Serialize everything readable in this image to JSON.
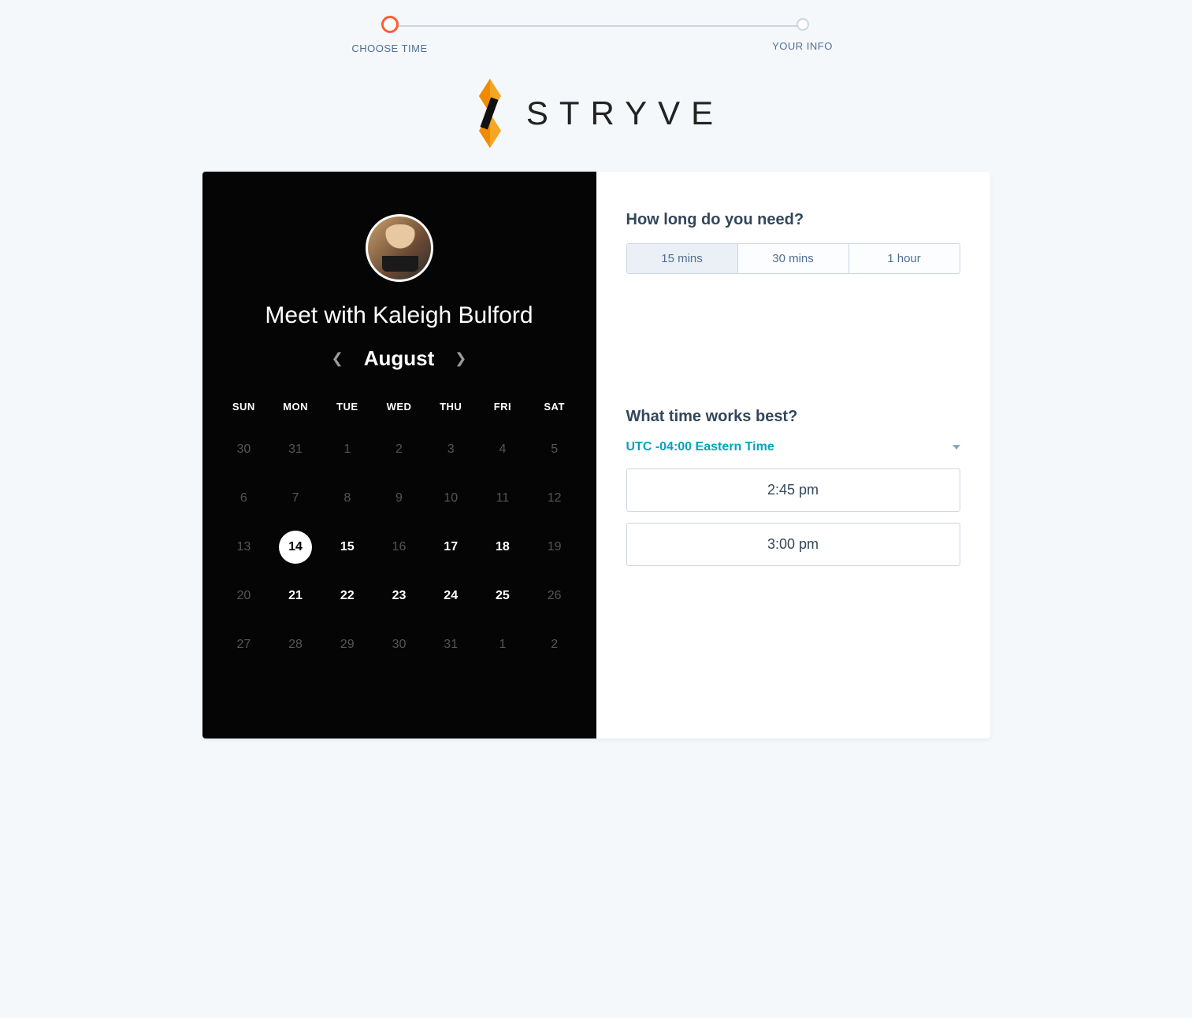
{
  "stepper": {
    "step1": "CHOOSE TIME",
    "step2": "YOUR INFO"
  },
  "brand": {
    "name": "STRYVE"
  },
  "left": {
    "title": "Meet with Kaleigh Bulford",
    "month": "August",
    "weekdays": [
      "SUN",
      "MON",
      "TUE",
      "WED",
      "THU",
      "FRI",
      "SAT"
    ],
    "weeks": [
      [
        {
          "n": "30",
          "enabled": false
        },
        {
          "n": "31",
          "enabled": false
        },
        {
          "n": "1",
          "enabled": false
        },
        {
          "n": "2",
          "enabled": false
        },
        {
          "n": "3",
          "enabled": false
        },
        {
          "n": "4",
          "enabled": false
        },
        {
          "n": "5",
          "enabled": false
        }
      ],
      [
        {
          "n": "6",
          "enabled": false
        },
        {
          "n": "7",
          "enabled": false
        },
        {
          "n": "8",
          "enabled": false
        },
        {
          "n": "9",
          "enabled": false
        },
        {
          "n": "10",
          "enabled": false
        },
        {
          "n": "11",
          "enabled": false
        },
        {
          "n": "12",
          "enabled": false
        }
      ],
      [
        {
          "n": "13",
          "enabled": false
        },
        {
          "n": "14",
          "enabled": true,
          "selected": true
        },
        {
          "n": "15",
          "enabled": true
        },
        {
          "n": "16",
          "enabled": false
        },
        {
          "n": "17",
          "enabled": true
        },
        {
          "n": "18",
          "enabled": true
        },
        {
          "n": "19",
          "enabled": false
        }
      ],
      [
        {
          "n": "20",
          "enabled": false
        },
        {
          "n": "21",
          "enabled": true
        },
        {
          "n": "22",
          "enabled": true
        },
        {
          "n": "23",
          "enabled": true
        },
        {
          "n": "24",
          "enabled": true
        },
        {
          "n": "25",
          "enabled": true
        },
        {
          "n": "26",
          "enabled": false
        }
      ],
      [
        {
          "n": "27",
          "enabled": false
        },
        {
          "n": "28",
          "enabled": false
        },
        {
          "n": "29",
          "enabled": false
        },
        {
          "n": "30",
          "enabled": false
        },
        {
          "n": "31",
          "enabled": false
        },
        {
          "n": "1",
          "enabled": false
        },
        {
          "n": "2",
          "enabled": false
        }
      ]
    ]
  },
  "right": {
    "duration_question": "How long do you need?",
    "durations": [
      {
        "label": "15 mins",
        "selected": true
      },
      {
        "label": "30 mins",
        "selected": false
      },
      {
        "label": "1 hour",
        "selected": false
      }
    ],
    "time_question": "What time works best?",
    "timezone": "UTC -04:00 Eastern Time",
    "times": [
      "2:45 pm",
      "3:00 pm"
    ]
  }
}
